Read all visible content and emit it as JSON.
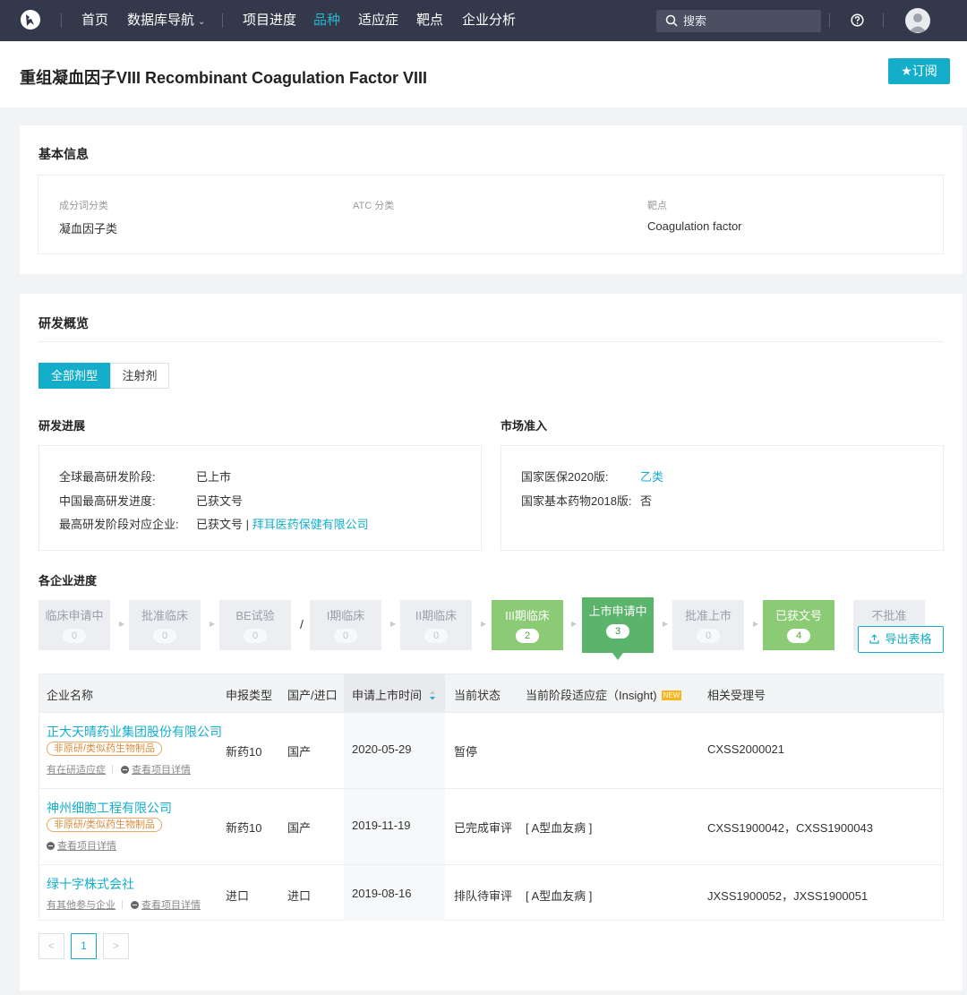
{
  "nav": {
    "home": "首页",
    "db_nav": "数据库导航",
    "progress": "项目进度",
    "variety": "品种",
    "indication": "适应症",
    "target": "靶点",
    "company": "企业分析",
    "search_placeholder": "搜索"
  },
  "header": {
    "title": "重组凝血因子VIII Recombinant Coagulation Factor VIII",
    "subscribe": "★订阅"
  },
  "basic": {
    "title": "基本信息",
    "ingredient_label": "成分词分类",
    "ingredient_value": "凝血因子类",
    "atc_label": "ATC 分类",
    "atc_value": "",
    "target_label": "靶点",
    "target_value": "Coagulation factor"
  },
  "rd": {
    "title": "研发概览",
    "tabs": [
      "全部剂型",
      "注射剂"
    ],
    "progress_title": "研发进展",
    "global_stage_label": "全球最高研发阶段:",
    "global_stage_value": "已上市",
    "china_stage_label": "中国最高研发进度:",
    "china_stage_value": "已获文号",
    "top_company_label": "最高研发阶段对应企业:",
    "top_company_prefix": "已获文号 |",
    "top_company_name": "拜耳医药保健有限公司",
    "market_title": "市场准入",
    "nhi_label": "国家医保2020版:",
    "nhi_value": "乙类",
    "essential_label": "国家基本药物2018版:",
    "essential_value": "否",
    "company_progress_title": "各企业进度",
    "export": "导出表格"
  },
  "stages": [
    {
      "name": "临床申请中",
      "count": "0"
    },
    {
      "name": "批准临床",
      "count": "0"
    },
    {
      "name": "BE试验",
      "count": "0"
    },
    {
      "name": "I期临床",
      "count": "0"
    },
    {
      "name": "II期临床",
      "count": "0"
    },
    {
      "name": "III期临床",
      "count": "2"
    },
    {
      "name": "上市申请中",
      "count": "3"
    },
    {
      "name": "批准上市",
      "count": "0"
    },
    {
      "name": "已获文号",
      "count": "4"
    },
    {
      "name": "不批准",
      "count": ""
    }
  ],
  "stage_separator": "/",
  "table": {
    "headers": {
      "company": "企业名称",
      "type": "申报类型",
      "origin": "国产/进口",
      "date": "申请上市时间",
      "status": "当前状态",
      "indication": "当前阶段适应症（Insight)",
      "new_badge": "NEW",
      "accept_no": "相关受理号"
    },
    "rows": [
      {
        "company": "正大天晴药业集团股份有限公司",
        "tag": "非原研/类似药生物制品",
        "link1": "有在研适应症",
        "link2": "查看项目详情",
        "type": "新药10",
        "origin": "国产",
        "date": "2020-05-29",
        "status": "暂停",
        "indication": "",
        "accept_no": "CXSS2000021"
      },
      {
        "company": "神州细胞工程有限公司",
        "tag": "非原研/类似药生物制品",
        "link2": "查看项目详情",
        "type": "新药10",
        "origin": "国产",
        "date": "2019-11-19",
        "status": "已完成审评",
        "indication": "[ A型血友病 ]",
        "accept_no": "CXSS1900042，CXSS1900043"
      },
      {
        "company": "绿十字株式会社",
        "link1": "有其他参与企业",
        "link2": "查看项目详情",
        "type": "进口",
        "origin": "进口",
        "date": "2019-08-16",
        "status": "排队待审评",
        "indication": "[ A型血友病 ]",
        "accept_no": "JXSS1900052，JXSS1900051"
      }
    ]
  },
  "pager": {
    "prev": "<",
    "current": "1",
    "next": ">"
  },
  "colors": {
    "accent": "#14aecb",
    "nav_bg": "#33394b",
    "stage_green": "#8ccb75",
    "stage_selected": "#5bb46c"
  }
}
